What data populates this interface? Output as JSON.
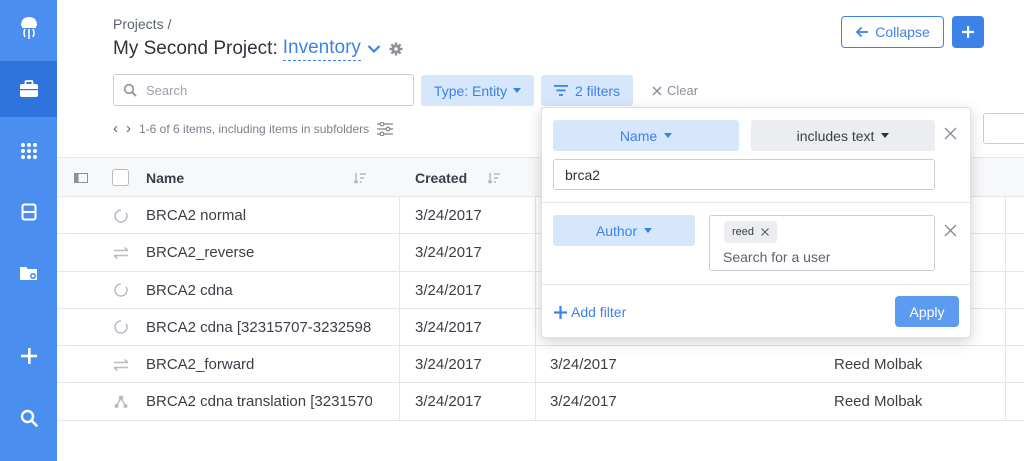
{
  "sidebar": {
    "items": [
      {
        "icon": "jellyfish-logo-icon",
        "active": false
      },
      {
        "icon": "briefcase-icon",
        "active": true
      },
      {
        "icon": "grid-icon",
        "active": false
      },
      {
        "icon": "document-icon",
        "active": false
      },
      {
        "icon": "folder-settings-icon",
        "active": false
      },
      {
        "icon": "plus-icon",
        "active": false
      },
      {
        "icon": "search-icon",
        "active": false
      }
    ]
  },
  "header": {
    "breadcrumb": "Projects /",
    "project_name": "My Second Project:",
    "view_name": "Inventory",
    "collapse_label": "Collapse"
  },
  "toolbar": {
    "search_placeholder": "Search",
    "type_filter_label": "Type: Entity",
    "filters_label": "2 filters",
    "clear_label": "Clear",
    "pager_text": "1-6 of 6 items, including items in subfolders"
  },
  "table": {
    "columns": [
      "Name",
      "Created"
    ],
    "rows": [
      {
        "icon": "circle-dashed-icon",
        "name": "BRCA2 normal",
        "created": "3/24/2017",
        "modified": "",
        "author": ""
      },
      {
        "icon": "arrows-swap-icon",
        "name": "BRCA2_reverse",
        "created": "3/24/2017",
        "modified": "",
        "author": ""
      },
      {
        "icon": "circle-dashed-icon",
        "name": "BRCA2 cdna",
        "created": "3/24/2017",
        "modified": "",
        "author": ""
      },
      {
        "icon": "circle-dashed-icon",
        "name": "BRCA2 cdna [32315707-3232598",
        "created": "3/24/2017",
        "modified": "",
        "author": ""
      },
      {
        "icon": "arrows-swap-icon",
        "name": "BRCA2_forward",
        "created": "3/24/2017",
        "modified": "3/24/2017",
        "author": "Reed Molbak"
      },
      {
        "icon": "molecule-icon",
        "name": "BRCA2 cdna translation [3231570",
        "created": "3/24/2017",
        "modified": "3/24/2017",
        "author": "Reed Molbak"
      }
    ]
  },
  "filter_popover": {
    "filter1_field": "Name",
    "filter1_operator": "includes text",
    "filter1_value": "brca2",
    "filter2_field": "Author",
    "filter2_chip": "reed",
    "filter2_placeholder": "Search for a user",
    "add_filter_label": "Add filter",
    "apply_label": "Apply"
  },
  "colors": {
    "sidebar": "#4a8ef0",
    "sidebar_active": "#2f73dc",
    "accent": "#3d82e6",
    "pill_bg": "#d6e6fb"
  }
}
